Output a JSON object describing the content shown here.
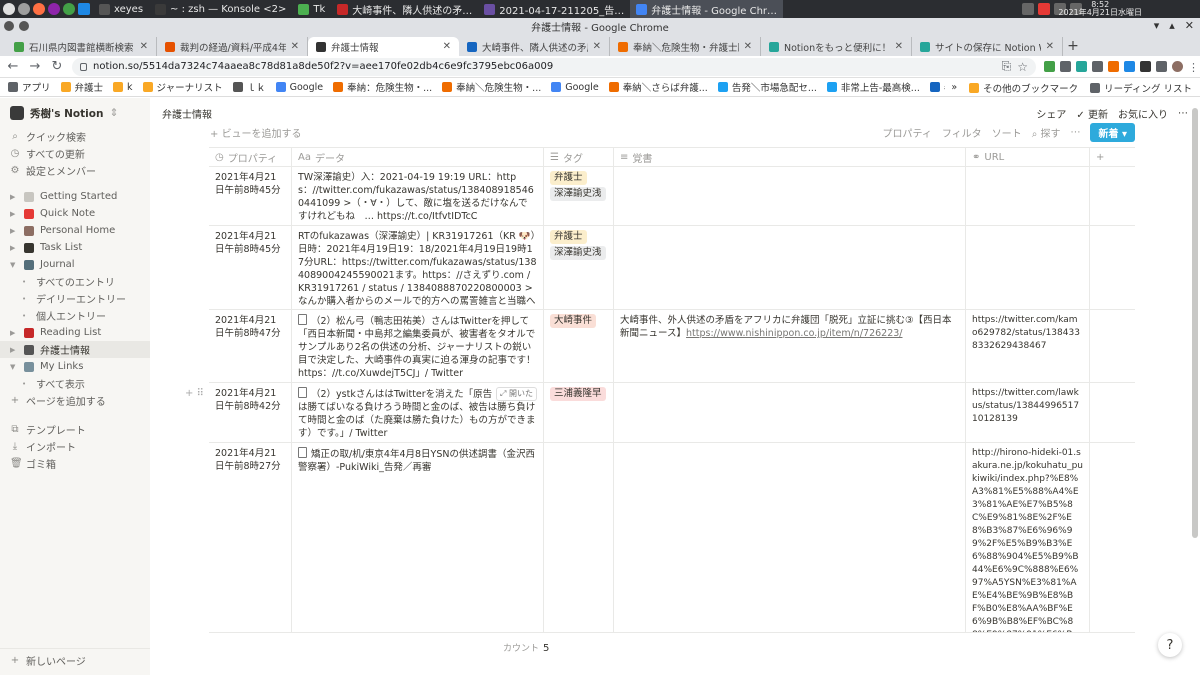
{
  "taskbar": {
    "windows": [
      {
        "label": "xeyes",
        "color": "#555555",
        "active": false
      },
      {
        "label": "~ : zsh — Konsole <2>",
        "color": "#3a3a3a",
        "active": false
      },
      {
        "label": "Tk",
        "color": "#4caf50",
        "active": false
      },
      {
        "label": "大崎事件、隣人供述の矛…",
        "color": "#c62828",
        "active": false
      },
      {
        "label": "2021-04-17-211205_告…",
        "color": "#6a4fa3",
        "active": false
      },
      {
        "label": "弁護士情報 - Google Chr…",
        "color": "#4285f4",
        "active": true
      }
    ],
    "clock_time": "8:52",
    "clock_date": "2021年4月21日水曜日"
  },
  "window": {
    "title": "弁護士情報 - Google Chrome"
  },
  "tabs": [
    {
      "label": "石川県内図書館横断検索",
      "color": "#43a047",
      "active": false
    },
    {
      "label": "裁判の経過/資料/平成4年4月8",
      "color": "#e65100",
      "active": false
    },
    {
      "label": "弁護士情報",
      "color": "#333333",
      "active": true
    },
    {
      "label": "大崎事件、隣人供述の矛盾を…",
      "color": "#1565c0",
      "active": false
    },
    {
      "label": "奉納＼危険生物・弁護士脳汚…",
      "color": "#ef6c00",
      "active": false
    },
    {
      "label": "Notionをもっと便利に！Chro…",
      "color": "#26a69a",
      "active": false
    },
    {
      "label": "サイトの保存に Notion Web C",
      "color": "#26a69a",
      "active": false
    }
  ],
  "address": {
    "url": "notion.so/5514da7324c74aaea8c78d81a8de50f2?v=aee170fe02db4c6e9fc3795ebc06a009"
  },
  "bookmarks": [
    {
      "label": "アプリ",
      "color": "#5f6368"
    },
    {
      "label": "弁護士",
      "color": "#f9a825"
    },
    {
      "label": "k",
      "color": "#f9a825"
    },
    {
      "label": "ジャーナリスト",
      "color": "#f9a825"
    },
    {
      "label": "ｌｋ",
      "color": "#555555"
    },
    {
      "label": "Google",
      "color": "#4285f4"
    },
    {
      "label": "奉納：危険生物・...",
      "color": "#ef6c00"
    },
    {
      "label": "奉納＼危険生物・...",
      "color": "#ef6c00"
    },
    {
      "label": "Google",
      "color": "#4285f4"
    },
    {
      "label": "奉納＼さらば弁護...",
      "color": "#ef6c00"
    },
    {
      "label": "告発＼市場急配セ...",
      "color": "#1da1f2"
    },
    {
      "label": "非常上告-最高検...",
      "color": "#1da1f2"
    },
    {
      "label": "奉納＼さらば弁護...",
      "color": "#1565c0"
    }
  ],
  "bookmarks_other": "その他のブックマーク",
  "bookmarks_reading": "リーディング リスト",
  "sidebar": {
    "workspace": "秀樹's Notion",
    "actions": [
      {
        "label": "クイック検索",
        "icon": "search-icon",
        "glyph": "⌕"
      },
      {
        "label": "すべての更新",
        "icon": "clock-icon",
        "glyph": "◷"
      },
      {
        "label": "設定とメンバー",
        "icon": "gear-icon",
        "glyph": "⚙"
      }
    ],
    "pages": [
      {
        "label": "Getting Started",
        "color": "#c8c6c0",
        "level": 0,
        "expanded": false,
        "active": false
      },
      {
        "label": "Quick Note",
        "color": "#e53935",
        "level": 0,
        "expanded": false,
        "active": false
      },
      {
        "label": "Personal Home",
        "color": "#8d6e63",
        "level": 0,
        "expanded": false,
        "active": false
      },
      {
        "label": "Task List",
        "color": "#37352f",
        "level": 0,
        "expanded": false,
        "active": false
      },
      {
        "label": "Journal",
        "color": "#546e7a",
        "level": 0,
        "expanded": true,
        "active": false
      },
      {
        "label": "すべてのエントリ",
        "color": "",
        "level": 1,
        "expanded": false,
        "active": false
      },
      {
        "label": "デイリーエントリー",
        "color": "",
        "level": 1,
        "expanded": false,
        "active": false
      },
      {
        "label": "個人エントリー",
        "color": "",
        "level": 1,
        "expanded": false,
        "active": false
      },
      {
        "label": "Reading List",
        "color": "#c62828",
        "level": 0,
        "expanded": false,
        "active": false
      },
      {
        "label": "弁護士情報",
        "color": "#555555",
        "level": 0,
        "expanded": false,
        "active": true
      },
      {
        "label": "My Links",
        "color": "#78909c",
        "level": 0,
        "expanded": true,
        "active": false
      },
      {
        "label": "すべて表示",
        "color": "",
        "level": 1,
        "expanded": false,
        "active": false
      }
    ],
    "add_page": "ページを追加する",
    "bottom": [
      {
        "label": "テンプレート",
        "icon": "template-icon",
        "glyph": "⧉"
      },
      {
        "label": "インポート",
        "icon": "import-icon",
        "glyph": "⤓"
      },
      {
        "label": "ゴミ箱",
        "icon": "trash-icon",
        "glyph": "🗑"
      }
    ],
    "new_page": "新しいページ"
  },
  "topbar": {
    "breadcrumb": "弁護士情報",
    "share": "シェア",
    "updates": "更新",
    "favorite": "お気に入り"
  },
  "viewbar": {
    "add_view": "ビューを追加する",
    "properties": "プロパティ",
    "filter": "フィルタ",
    "sort": "ソート",
    "search": "探す",
    "new": "新着"
  },
  "table": {
    "columns": [
      {
        "label": "プロパティ",
        "icon": "◷"
      },
      {
        "label": "データ",
        "icon": "Aa"
      },
      {
        "label": "タグ",
        "icon": "☰"
      },
      {
        "label": "覚書",
        "icon": "≡"
      },
      {
        "label": "URL",
        "icon": "⚭"
      },
      {
        "label": "+",
        "icon": ""
      }
    ],
    "rows": [
      {
        "date": "2021年4月21日午前8時45分",
        "page_icon": false,
        "data": "TW深澤諭史）入：2021-04-19 19:19 URL：https：//twitter.com/fukazawas/status/1384089185460441099 >（・∀・）して、敵に塩を送るだけなんですけれどもね　… https://t.co/ItfvtIDTcC",
        "tags": [
          {
            "label": "弁護士",
            "bg": "#fbeecc"
          },
          {
            "label": "深澤諭史浅",
            "bg": "#ebeced"
          }
        ],
        "memo": "",
        "memo_link": "",
        "url": ""
      },
      {
        "date": "2021年4月21日午前8時45分",
        "page_icon": false,
        "data": "RTのfukazawas（深澤諭史）| KR31917261（KR 🐶）日時：2021年4月19日19：18/2021年4月19日19時17分URL：https://twitter.com/fukazawas/status/1384089004245590021ます。https：//さえずり.com / KR31917261 / status / 1384088870220800003 >なんか購入者からのメールで的方への罵詈雑言と当職への不満が長文でした…な。",
        "tags": [
          {
            "label": "弁護士",
            "bg": "#fbeecc"
          },
          {
            "label": "深澤諭史浅",
            "bg": "#ebeced"
          }
        ],
        "memo": "",
        "memo_link": "",
        "url": ""
      },
      {
        "date": "2021年4月21日午前8時47分",
        "page_icon": true,
        "data": "（2）松ん弓（鴨志田祐美）さんはTwitterを押して「西日本新聞・中島邦之編集委員が、被害者をタオルでサンプルあり2名の供述の分析、ジャーナリストの鋭い目で決定した、大崎事件の真実に迫る渾身の記事です！https：//t.co/XuwdejT5CJ」/ Twitter",
        "tags": [
          {
            "label": "大崎事件",
            "bg": "#fadfd6"
          }
        ],
        "memo": "大崎事件、外人供述の矛盾をアフリカに弁護団「脱死」立証に挑む③【西日本新聞ニュース】",
        "memo_link": "https://www.nishinippon.co.jp/item/n/726223/",
        "url": "https://twitter.com/kamo629782/status/1384338332629438467"
      },
      {
        "date": "2021年4月21日午前8時42分",
        "page_icon": true,
        "data": "（2）ystkさんははTwitterを消えた「原告は勝てばいなる負けろう時間と金のば、被告は勝ち負けて時間と金のば（た廃棄は勝た負けた）もの方ができます）です。」/ Twitter",
        "open_label": "開いた",
        "tags": [
          {
            "label": "三浦義隆早",
            "bg": "#fadcdb"
          }
        ],
        "memo": "",
        "memo_link": "",
        "url": "https://twitter.com/lawkus/status/1384499651710128139"
      },
      {
        "date": "2021年4月21日午前8時27分",
        "page_icon": true,
        "data": "矯正の取/机/東京4年4月8日YSNの供述調書（金沢西警察署）-PukiWiki_告発／再審",
        "tags": [],
        "memo": "",
        "memo_link": "",
        "url": "http://hirono-hideki-01.sakura.ne.jp/kokuhatu_pukiwiki/index.php?%E8%A3%81%E5%88%A4%E3%81%AE%E7%B5%8C%E9%81%8E%2F%E8%B3%87%E6%96%99%2F%E5%B9%B3%E6%88%904%E5%B9%B44%E6%9C%888%E6%97%A5YSN%E3%81%AE%E4%BE%9B%E8%BF%B0%E8%AA%BF%E6%9B%B8%EF%BC%88%E9%87%91%E6%B2%A2%E8%A5%BF%E8%AD%A6%E5%AF%9F"
      }
    ],
    "count_label": "カウント",
    "count_value": "5"
  }
}
